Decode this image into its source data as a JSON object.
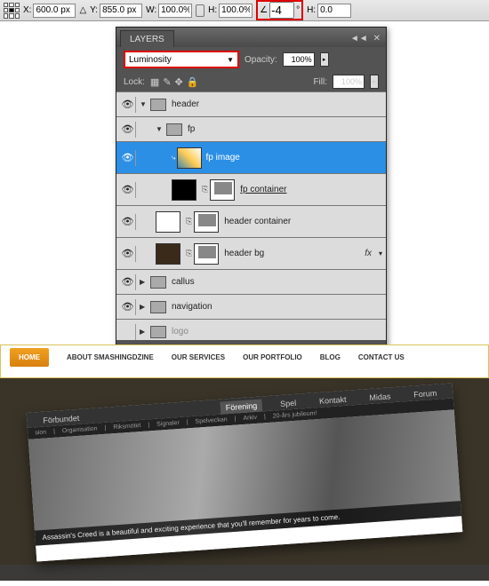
{
  "options_bar": {
    "x_label": "X:",
    "x_value": "600.0 px",
    "y_label": "Y:",
    "y_value": "855.0 px",
    "w_label": "W:",
    "w_value": "100.0%",
    "h_label": "H:",
    "h_value": "100.0%",
    "rotate_value": "-4",
    "rotate_deg": "°",
    "skew_h_label": "H:",
    "skew_h_value": "0.0"
  },
  "layers": {
    "tab": "LAYERS",
    "blend_mode": "Luminosity",
    "opacity_label": "Opacity:",
    "opacity_value": "100%",
    "lock_label": "Lock:",
    "fill_label": "Fill:",
    "fill_value": "100%",
    "rows": [
      {
        "name": "header",
        "type": "group"
      },
      {
        "name": "fp",
        "type": "group"
      },
      {
        "name": "fp image",
        "type": "layer"
      },
      {
        "name": "fp container",
        "type": "layer"
      },
      {
        "name": "header container",
        "type": "layer"
      },
      {
        "name": "header bg",
        "type": "layer",
        "fx": "fx"
      },
      {
        "name": "callus",
        "type": "group"
      },
      {
        "name": "navigation",
        "type": "group"
      },
      {
        "name": "logo",
        "type": "group"
      }
    ]
  },
  "site_nav": {
    "items": [
      "HOME",
      "ABOUT SMASHINGDZINE",
      "OUR SERVICES",
      "OUR PORTFOLIO",
      "BLOG",
      "CONTACT US"
    ]
  },
  "rotated_nav": {
    "top": [
      "Förening",
      "Spel",
      "Kontakt",
      "Midas",
      "Forum"
    ],
    "left": "Förbundet",
    "sub": [
      "sion",
      "Organisation",
      "Riksmötet",
      "Signaler",
      "Spelveckan",
      "Arkiv",
      "20-års jubileum!"
    ],
    "caption": "Assassin's Creed is a beautiful and exciting experience that you'll remember for years to come."
  }
}
